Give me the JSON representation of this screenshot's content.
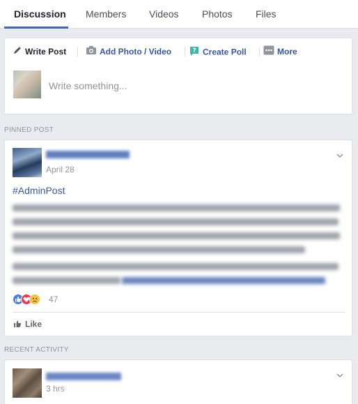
{
  "tabs": [
    {
      "label": "Discussion",
      "active": true
    },
    {
      "label": "Members"
    },
    {
      "label": "Videos"
    },
    {
      "label": "Photos"
    },
    {
      "label": "Files"
    }
  ],
  "composer": {
    "write_post": "Write Post",
    "add_photo": "Add Photo / Video",
    "create_poll": "Create Poll",
    "more": "More",
    "placeholder": "Write something..."
  },
  "sections": {
    "pinned": "PINNED POST",
    "recent": "RECENT ACTIVITY"
  },
  "pinned_post": {
    "time": "April 28",
    "hashtag": "#AdminPost",
    "reaction_count": "47",
    "like_label": "Like",
    "reactions": [
      "like",
      "love",
      "sad"
    ]
  },
  "recent_post": {
    "time": "3 hrs"
  },
  "colors": {
    "accent": "#4267b2",
    "link": "#365899",
    "background": "#e9ebee"
  }
}
